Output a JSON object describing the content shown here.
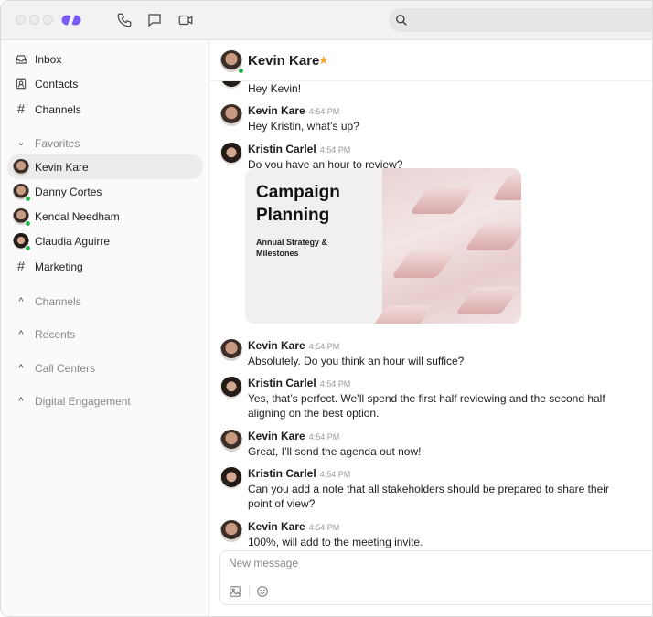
{
  "titlebar": {
    "brand_color": "#7b5cf5",
    "icons": [
      "phone-icon",
      "chat-icon",
      "video-icon"
    ],
    "search_icon": "search-icon"
  },
  "sidebar": {
    "nav": [
      {
        "label": "Inbox",
        "icon": "inbox-icon"
      },
      {
        "label": "Contacts",
        "icon": "contacts-icon"
      },
      {
        "label": "Channels",
        "icon": "hash-icon"
      }
    ],
    "favorites_label": "Favorites",
    "favorites": [
      {
        "label": "Kevin Kare",
        "active": true,
        "online": false
      },
      {
        "label": "Danny Cortes",
        "online": true
      },
      {
        "label": "Kendal Needham",
        "online": true
      },
      {
        "label": "Claudia Aguirre",
        "online": true
      },
      {
        "label": "Marketing",
        "icon": "hash-icon"
      }
    ],
    "sections": [
      "Channels",
      "Recents",
      "Call Centers",
      "Digital Engagement"
    ]
  },
  "chat": {
    "contact": "Kevin Kare",
    "starred": true,
    "star_color": "#f5a623",
    "partial_message": "Hey Kevin!",
    "messages": [
      {
        "sender": "Kevin Kare",
        "time": "4:54 PM",
        "text": "Hey Kristin, what’s up?"
      },
      {
        "sender": "Kristin Carlel",
        "time": "4:54 PM",
        "text": "Do you have an hour to review?"
      },
      {
        "sender": "Kevin Kare",
        "time": "4:54 PM",
        "text": "Absolutely. Do you think an hour will suffice?"
      },
      {
        "sender": "Kristin Carlel",
        "time": "4:54 PM",
        "text": "Yes, that’s perfect. We’ll spend the first half reviewing and the second half aligning on the best option."
      },
      {
        "sender": "Kevin Kare",
        "time": "4:54 PM",
        "text": "Great, I’ll send the agenda out now!"
      },
      {
        "sender": "Kristin Carlel",
        "time": "4:54 PM",
        "text": "Can you add a note that all stakeholders should be prepared to share their point of view?"
      },
      {
        "sender": "Kevin Kare",
        "time": "4:54 PM",
        "text": "100%, will add to the meeting invite."
      }
    ],
    "attachment": {
      "title": "Campaign Planning",
      "subtitle": "Annual Strategy & Milestones"
    }
  },
  "composer": {
    "placeholder": "New message",
    "icons": [
      "image-icon",
      "emoji-icon"
    ]
  }
}
